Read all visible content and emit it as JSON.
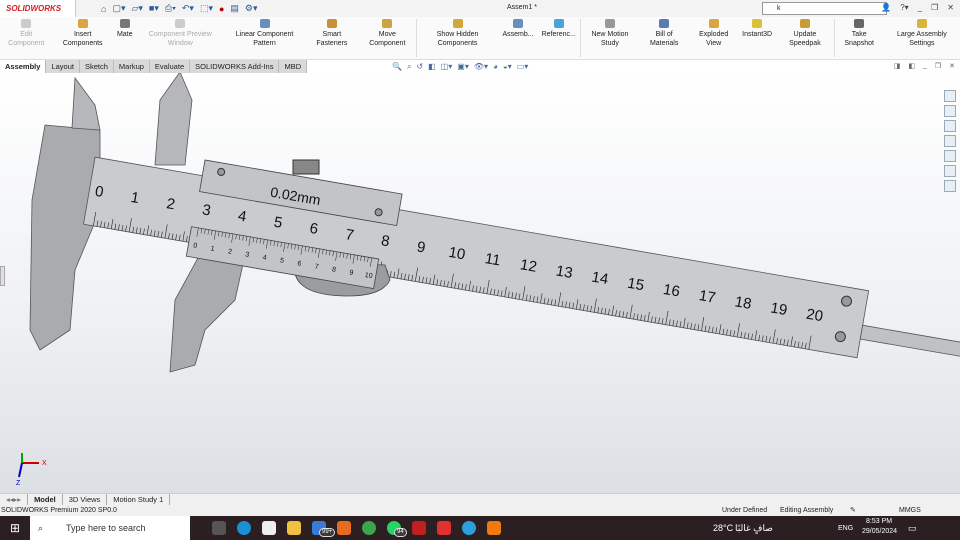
{
  "app": {
    "logo": "SOLIDWORKS",
    "doc_title": "Assem1 *",
    "search_value": "k"
  },
  "ribbon": [
    {
      "label": "Edit Component",
      "disabled": true
    },
    {
      "label": "Insert Components"
    },
    {
      "label": "Mate"
    },
    {
      "label": "Component Preview Window",
      "disabled": true
    },
    {
      "label": "Linear Component Pattern"
    },
    {
      "label": "Smart Fasteners"
    },
    {
      "label": "Move Component"
    },
    {
      "label": "Show Hidden Components"
    },
    {
      "label": "Assemb..."
    },
    {
      "label": "Referenc..."
    },
    {
      "label": "New Motion Study"
    },
    {
      "label": "Bill of Materials"
    },
    {
      "label": "Exploded View"
    },
    {
      "label": "Instant3D"
    },
    {
      "label": "Update Speedpak"
    },
    {
      "label": "Take Snapshot"
    },
    {
      "label": "Large Assembly Settings"
    }
  ],
  "tabs": [
    "Assembly",
    "Layout",
    "Sketch",
    "Markup",
    "Evaluate",
    "SOLIDWORKS Add-Ins",
    "MBD"
  ],
  "model": {
    "main_scale": [
      "0",
      "1",
      "2",
      "3",
      "4",
      "5",
      "6",
      "7",
      "8",
      "9",
      "10",
      "11",
      "12",
      "13",
      "14",
      "15",
      "16",
      "17",
      "18",
      "19",
      "20"
    ],
    "vernier_scale": [
      "0",
      "1",
      "2",
      "3",
      "4",
      "5",
      "6",
      "7",
      "8",
      "9",
      "10"
    ],
    "resolution": "0.02mm"
  },
  "triad": {
    "x": "X",
    "y": "Y",
    "z": "Z"
  },
  "bottom_tabs": [
    "Model",
    "3D Views",
    "Motion Study 1"
  ],
  "status": {
    "product": "SOLIDWORKS Premium 2020 SP0.0",
    "state": "Under Defined",
    "mode": "Editing Assembly",
    "units": "MMGS"
  },
  "taskbar": {
    "search_placeholder": "Type here to search",
    "weather": "28°C",
    "weather_text": "صافٍ غالبًا",
    "lang": "ENG",
    "time": "8:53 PM",
    "date": "29/05/2024",
    "badge_mail": "99+",
    "badge_whatsapp": "94"
  }
}
